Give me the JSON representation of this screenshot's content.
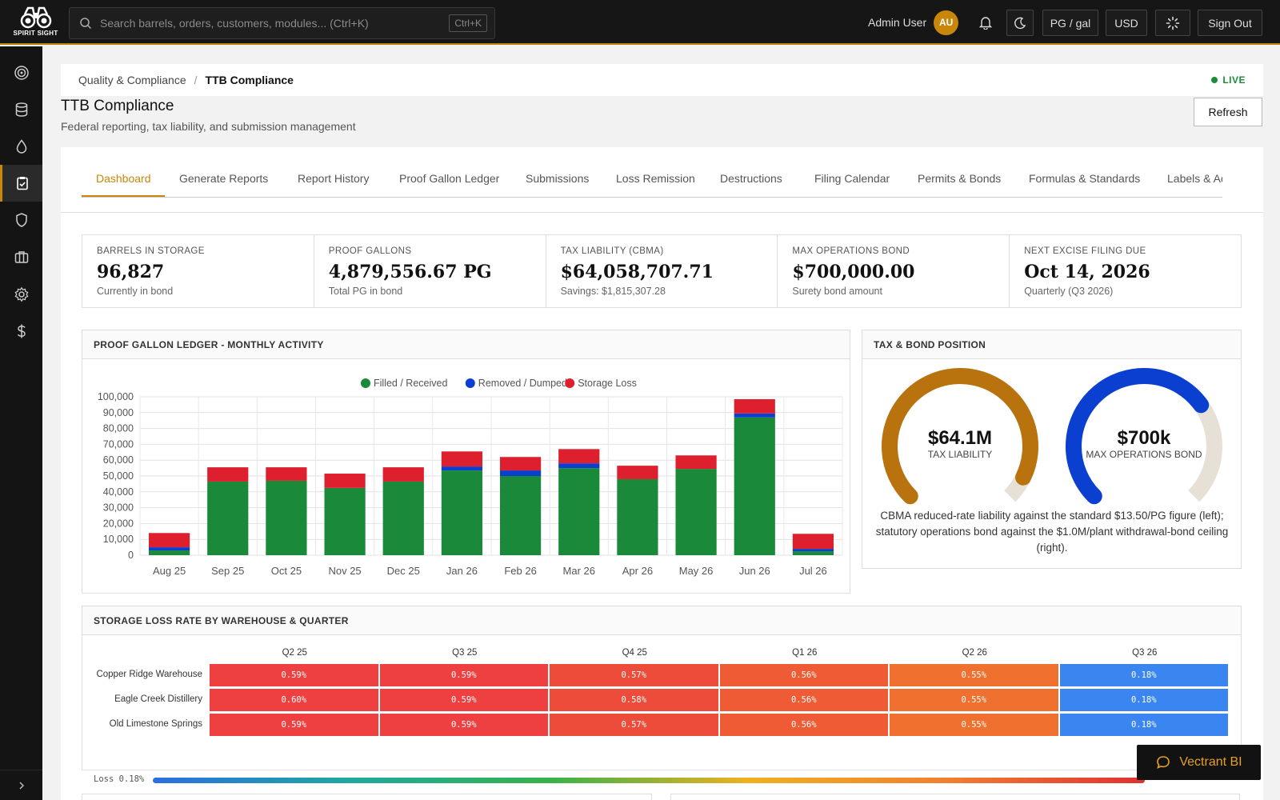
{
  "app": {
    "logo_text": "SPIRIT SIGHT",
    "search_placeholder": "Search barrels, orders, customers, modules... (Ctrl+K)",
    "search_shortcut": "Ctrl+K",
    "user_name": "Admin User",
    "user_initials": "AU",
    "unit_button": "PG / gal",
    "currency_button": "USD",
    "sign_out": "Sign Out",
    "accent_color": "#c8860b"
  },
  "sidebar": {
    "items": [
      {
        "icon": "target-icon"
      },
      {
        "icon": "database-icon"
      },
      {
        "icon": "droplet-icon"
      },
      {
        "icon": "clipboard-check-icon",
        "active": true
      },
      {
        "icon": "shield-icon"
      },
      {
        "icon": "briefcase-icon"
      },
      {
        "icon": "gear-icon"
      },
      {
        "icon": "dollar-icon"
      }
    ]
  },
  "breadcrumb": {
    "parent": "Quality & Compliance",
    "separator": "/",
    "current": "TTB Compliance",
    "status": "LIVE"
  },
  "page": {
    "title": "TTB Compliance",
    "subtitle": "Federal reporting, tax liability, and submission management",
    "refresh": "Refresh"
  },
  "tabs": [
    "Dashboard",
    "Generate Reports",
    "Report History",
    "Proof Gallon Ledger",
    "Submissions",
    "Loss Remission",
    "Destructions",
    "Filing Calendar",
    "Permits & Bonds",
    "Formulas & Standards",
    "Labels & Adver"
  ],
  "kpis": [
    {
      "label": "BARRELS IN STORAGE",
      "value": "96,827",
      "sub": "Currently in bond"
    },
    {
      "label": "PROOF GALLONS",
      "value": "4,879,556.67 PG",
      "sub": "Total PG in bond"
    },
    {
      "label": "TAX LIABILITY (CBMA)",
      "value": "$64,058,707.71",
      "sub": "Savings: $1,815,307.28"
    },
    {
      "label": "MAX OPERATIONS BOND",
      "value": "$700,000.00",
      "sub": "Surety bond amount"
    },
    {
      "label": "NEXT EXCISE FILING DUE",
      "value": "Oct 14, 2026",
      "sub": "Quarterly (Q3 2026)"
    }
  ],
  "ledger_card": {
    "title": "PROOF GALLON LEDGER - MONTHLY ACTIVITY"
  },
  "chart_data": {
    "type": "bar",
    "stacked": true,
    "categories": [
      "Aug 25",
      "Sep 25",
      "Oct 25",
      "Nov 25",
      "Dec 25",
      "Jan 26",
      "Feb 26",
      "Mar 26",
      "Apr 26",
      "May 26",
      "Jun 26",
      "Jul 26"
    ],
    "series": [
      {
        "name": "Filled / Received",
        "color": "#1a8a3a",
        "values": [
          3000,
          46500,
          47000,
          42500,
          46500,
          53500,
          50000,
          55000,
          48000,
          54500,
          87000,
          2500
        ]
      },
      {
        "name": "Removed / Dumped",
        "color": "#0a3fd0",
        "values": [
          2000,
          0,
          0,
          0,
          0,
          2500,
          3500,
          3000,
          0,
          0,
          2500,
          1500
        ]
      },
      {
        "name": "Storage Loss",
        "color": "#dd1f2e",
        "values": [
          9000,
          9000,
          8500,
          9000,
          9000,
          9500,
          8500,
          9000,
          8500,
          8500,
          9000,
          9500
        ]
      }
    ],
    "yticks": [
      "0",
      "10,000",
      "20,000",
      "30,000",
      "40,000",
      "50,000",
      "60,000",
      "70,000",
      "80,000",
      "90,000",
      "100,000"
    ],
    "ylim": [
      0,
      100000
    ],
    "legend": "top-center",
    "grid": true
  },
  "tax_card": {
    "title": "TAX & BOND POSITION",
    "gauges": [
      {
        "value": "$64.1M",
        "label": "TAX LIABILITY",
        "fraction": 0.93,
        "color": "#b8730f"
      },
      {
        "value": "$700k",
        "label": "MAX OPERATIONS BOND",
        "fraction": 0.7,
        "color": "#0a3fd0"
      }
    ],
    "caption": "CBMA reduced-rate liability against the standard $13.50/PG figure (left); statutory operations bond against the $1.0M/plant withdrawal-bond ceiling (right)."
  },
  "heatmap": {
    "title": "STORAGE LOSS RATE BY WAREHOUSE & QUARTER",
    "columns": [
      "Q2 25",
      "Q3 25",
      "Q4 25",
      "Q1 26",
      "Q2 26",
      "Q3 26"
    ],
    "rows": [
      {
        "name": "Copper Ridge Warehouse",
        "cells": [
          "0.59%",
          "0.59%",
          "0.57%",
          "0.56%",
          "0.55%",
          "0.18%"
        ]
      },
      {
        "name": "Eagle Creek Distillery",
        "cells": [
          "0.60%",
          "0.59%",
          "0.58%",
          "0.56%",
          "0.55%",
          "0.18%"
        ]
      },
      {
        "name": "Old Limestone Springs",
        "cells": [
          "0.59%",
          "0.59%",
          "0.57%",
          "0.56%",
          "0.55%",
          "0.18%"
        ]
      }
    ],
    "colors": [
      "#ee4040",
      "#ee4040",
      "#ee4c3a",
      "#ef5b35",
      "#f07030",
      "#3a85f0"
    ],
    "legend_low": "Loss 0.18%"
  },
  "assistant": {
    "label": "Vectrant BI"
  }
}
